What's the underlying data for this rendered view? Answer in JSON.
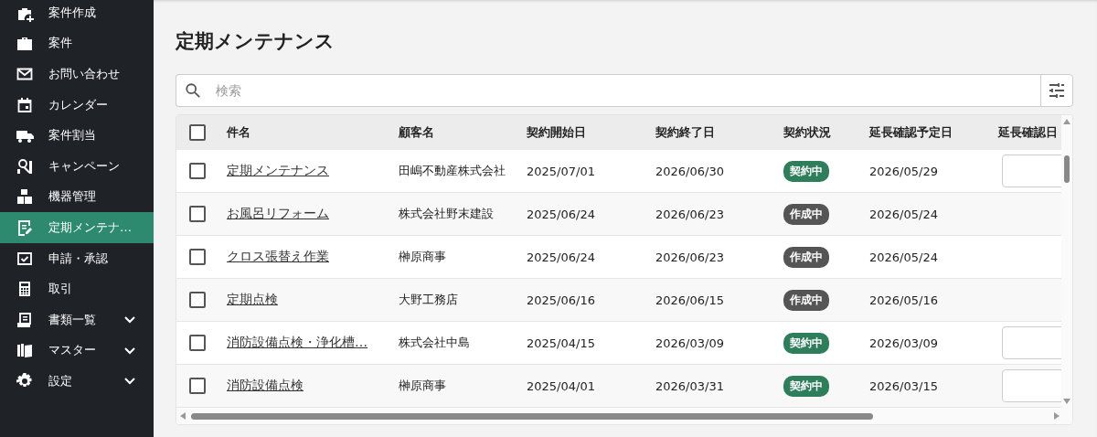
{
  "sidebar": {
    "items": [
      {
        "label": "案件作成",
        "selected": false,
        "expandable": false
      },
      {
        "label": "案件",
        "selected": false,
        "expandable": false
      },
      {
        "label": "お問い合わせ",
        "selected": false,
        "expandable": false
      },
      {
        "label": "カレンダー",
        "selected": false,
        "expandable": false
      },
      {
        "label": "案件割当",
        "selected": false,
        "expandable": false
      },
      {
        "label": "キャンペーン",
        "selected": false,
        "expandable": false
      },
      {
        "label": "機器管理",
        "selected": false,
        "expandable": false
      },
      {
        "label": "定期メンテナ…",
        "selected": true,
        "expandable": false
      },
      {
        "label": "申請・承認",
        "selected": false,
        "expandable": false
      },
      {
        "label": "取引",
        "selected": false,
        "expandable": false
      },
      {
        "label": "書類一覧",
        "selected": false,
        "expandable": true
      },
      {
        "label": "マスター",
        "selected": false,
        "expandable": true
      },
      {
        "label": "設定",
        "selected": false,
        "expandable": true
      }
    ]
  },
  "page_title": "定期メンテナンス",
  "search": {
    "placeholder": "検索"
  },
  "table": {
    "columns": [
      "件名",
      "顧客名",
      "契約開始日",
      "契約終了日",
      "契約状況",
      "延長確認予定日",
      "延長確認日"
    ],
    "select_all_checked": false,
    "rows": [
      {
        "checked": false,
        "name": "定期メンテナンス",
        "customer": "田嶋不動産株式会社",
        "start": "2025/07/01",
        "end": "2026/06/30",
        "status": {
          "kind": "active",
          "label": "契約中"
        },
        "planned": "2026/05/29",
        "has_date_field": true
      },
      {
        "checked": false,
        "name": "お風呂リフォーム",
        "customer": "株式会社野末建設",
        "start": "2025/06/24",
        "end": "2026/06/23",
        "status": {
          "kind": "draft",
          "label": "作成中"
        },
        "planned": "2026/05/24",
        "has_date_field": false
      },
      {
        "checked": false,
        "name": "クロス張替え作業",
        "customer": "榊原商事",
        "start": "2025/06/24",
        "end": "2026/06/23",
        "status": {
          "kind": "draft",
          "label": "作成中"
        },
        "planned": "2026/05/24",
        "has_date_field": false
      },
      {
        "checked": false,
        "name": "定期点検",
        "customer": "大野工務店",
        "start": "2025/06/16",
        "end": "2026/06/15",
        "status": {
          "kind": "draft",
          "label": "作成中"
        },
        "planned": "2026/05/16",
        "has_date_field": false
      },
      {
        "checked": false,
        "name": "消防設備点検・浄化槽…",
        "customer": "株式会社中島",
        "start": "2025/04/15",
        "end": "2026/03/09",
        "status": {
          "kind": "active",
          "label": "契約中"
        },
        "planned": "2026/03/09",
        "has_date_field": true
      },
      {
        "checked": false,
        "name": "消防設備点検",
        "customer": "榊原商事",
        "start": "2025/04/01",
        "end": "2026/03/31",
        "status": {
          "kind": "active",
          "label": "契約中"
        },
        "planned": "2026/03/15",
        "has_date_field": true
      }
    ]
  }
}
